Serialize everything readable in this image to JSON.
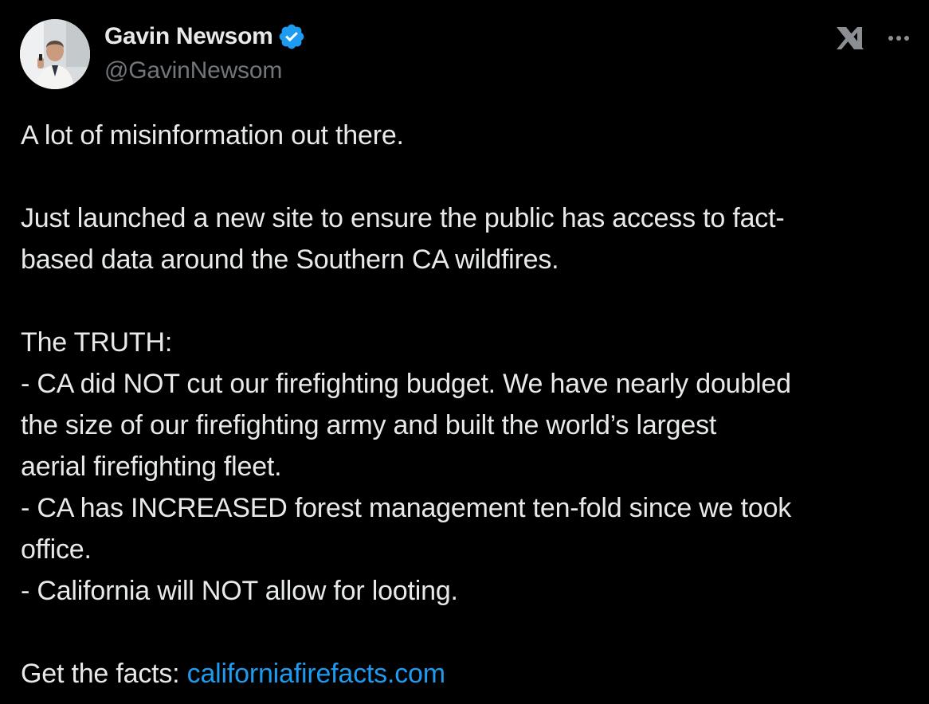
{
  "author": {
    "display_name": "Gavin Newsom",
    "handle": "@GavinNewsom",
    "verified": true,
    "avatar_icon": "profile-photo"
  },
  "icons": {
    "verified_badge": "verified-badge-icon",
    "x_logo": "x-logo-icon",
    "more": "more-options-icon"
  },
  "colors": {
    "background": "#000000",
    "text": "#e7e9ea",
    "secondary_text": "#71767b",
    "link": "#1d9bf0",
    "verified_badge": "#1d9bf0"
  },
  "tweet": {
    "line1": "A lot of misinformation out there.",
    "line2a": "Just launched a new site to ensure the public has access to fact-",
    "line2b": "based data around the Southern CA wildfires.",
    "line3": "The TRUTH:",
    "line4a": "- CA did NOT cut our firefighting budget. We have nearly doubled",
    "line4b": "the size of our firefighting army and built the world’s largest",
    "line4c": "aerial firefighting fleet.",
    "line5a": "- CA has INCREASED forest management ten-fold since we took",
    "line5b": "office.",
    "line6": "- California will NOT allow for looting.",
    "cta_prefix": "Get the facts: ",
    "cta_link": "californiafirefacts.com"
  }
}
